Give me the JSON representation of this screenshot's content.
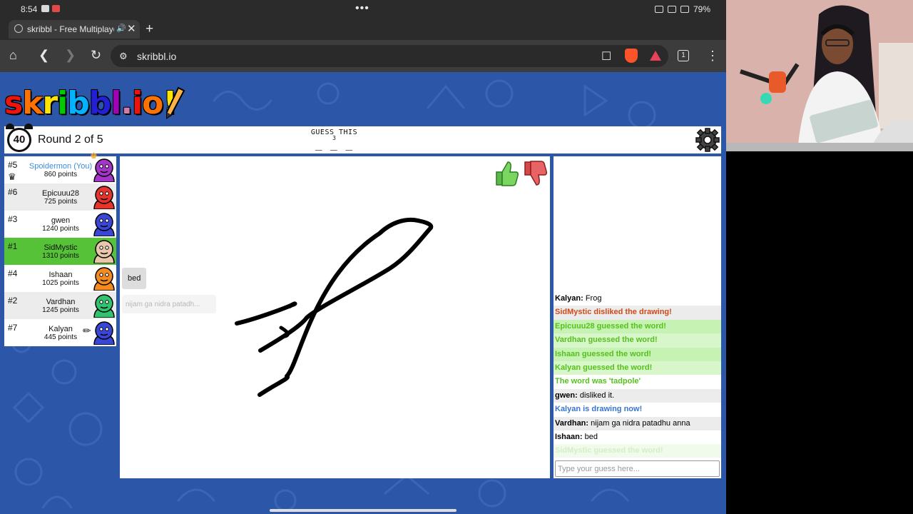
{
  "status": {
    "time": "8:54",
    "battery": "79%"
  },
  "browser": {
    "tab_title": "skribbl - Free Multiplayer",
    "url": "skribbl.io",
    "tab_count": "1"
  },
  "game": {
    "logo_letters": [
      "s",
      "k",
      "r",
      "i",
      "b",
      "b",
      "l",
      ".",
      "i",
      "o",
      "!"
    ],
    "logo_colors": [
      "#ef130b",
      "#ff7100",
      "#ffe400",
      "#00cc00",
      "#00b2ff",
      "#231fd3",
      "#a300ba",
      "#d37caa",
      "#ef130b",
      "#ff7100",
      "#ffe400"
    ],
    "timer": "40",
    "round": "Round 2 of 5",
    "guess_label": "GUESS THIS",
    "letter_count": "3",
    "blanks": "_ _ _"
  },
  "players": [
    {
      "rank": "#5",
      "name": "Spoidermon (You)",
      "points": "860 points",
      "avatar_color": "#a535c9",
      "self": true,
      "crown": true,
      "drawing": false,
      "highlight": false
    },
    {
      "rank": "#6",
      "name": "Epicuuu28",
      "points": "725 points",
      "avatar_color": "#e8322c",
      "self": false,
      "crown": false,
      "drawing": false,
      "highlight": false
    },
    {
      "rank": "#3",
      "name": "gwen",
      "points": "1240 points",
      "avatar_color": "#3a46d6",
      "self": false,
      "crown": false,
      "drawing": false,
      "highlight": false
    },
    {
      "rank": "#1",
      "name": "SidMystic",
      "points": "1310 points",
      "avatar_color": "#e8c7a8",
      "self": false,
      "crown": false,
      "drawing": false,
      "highlight": true
    },
    {
      "rank": "#4",
      "name": "Ishaan",
      "points": "1025 points",
      "avatar_color": "#f58a1f",
      "self": false,
      "crown": false,
      "drawing": false,
      "highlight": false
    },
    {
      "rank": "#2",
      "name": "Vardhan",
      "points": "1245 points",
      "avatar_color": "#2fc46d",
      "self": false,
      "crown": false,
      "drawing": false,
      "highlight": false
    },
    {
      "rank": "#7",
      "name": "Kalyan",
      "points": "445 points",
      "avatar_color": "#3a46d6",
      "self": false,
      "crown": false,
      "drawing": true,
      "highlight": false
    }
  ],
  "bubbles": {
    "ishaan": "bed",
    "vardhan": "nijam ga nidra patadh..."
  },
  "chat": {
    "messages": [
      {
        "type": "normal",
        "author": "Kalyan:",
        "text": "Frog"
      },
      {
        "type": "liked",
        "author": "",
        "text": "SidMystic disliked the drawing!"
      },
      {
        "type": "guessed",
        "author": "",
        "text": "Epicuuu28 guessed the word!"
      },
      {
        "type": "guessed",
        "author": "",
        "text": "Vardhan guessed the word!"
      },
      {
        "type": "guessed",
        "author": "",
        "text": "Ishaan guessed the word!"
      },
      {
        "type": "guessed",
        "author": "",
        "text": "Kalyan guessed the word!"
      },
      {
        "type": "reveal",
        "author": "",
        "text": "The word was 'tadpole'"
      },
      {
        "type": "normal",
        "author": "gwen:",
        "text": "disliked it."
      },
      {
        "type": "drawing",
        "author": "",
        "text": "Kalyan is drawing now!"
      },
      {
        "type": "normal",
        "author": "Vardhan:",
        "text": "nijam ga nidra patadhu anna"
      },
      {
        "type": "normal",
        "author": "Ishaan:",
        "text": "bed"
      },
      {
        "type": "fade",
        "author": "",
        "text": "SidMystic guessed the word!"
      }
    ],
    "input_placeholder": "Type your guess here..."
  }
}
